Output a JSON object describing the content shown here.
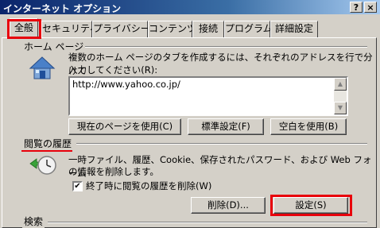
{
  "window": {
    "title": "インターネット オプション",
    "help_btn": "?",
    "close_btn": "×"
  },
  "tabs": [
    {
      "label": "全般",
      "active": true
    },
    {
      "label": "セキュリティ"
    },
    {
      "label": "プライバシー"
    },
    {
      "label": "コンテンツ"
    },
    {
      "label": "接続"
    },
    {
      "label": "プログラム"
    },
    {
      "label": "詳細設定"
    }
  ],
  "home_page": {
    "group_label": "ホーム ページ",
    "description_line1": "複数のホーム ページのタブを作成するには、それぞれのアドレスを行で分けて",
    "description_line2": "入力してください(R):",
    "url_value": "http://www.yahoo.co.jp/",
    "use_current_label": "現在のページを使用(C)",
    "use_default_label": "標準設定(F)",
    "use_blank_label": "空白を使用(B)"
  },
  "history": {
    "group_label": "閲覧の履歴",
    "description_line1": "一時ファイル、履歴、Cookie、保存されたパスワード、および Web フォーム",
    "description_line2": "の情報を削除します。",
    "checkbox_label": "終了時に閲覧の履歴を削除(W)",
    "checkbox_checked": true,
    "delete_label": "削除(D)...",
    "settings_label": "設定(S)"
  },
  "search": {
    "group_label": "検索"
  },
  "annotation_color": "#e8000b"
}
